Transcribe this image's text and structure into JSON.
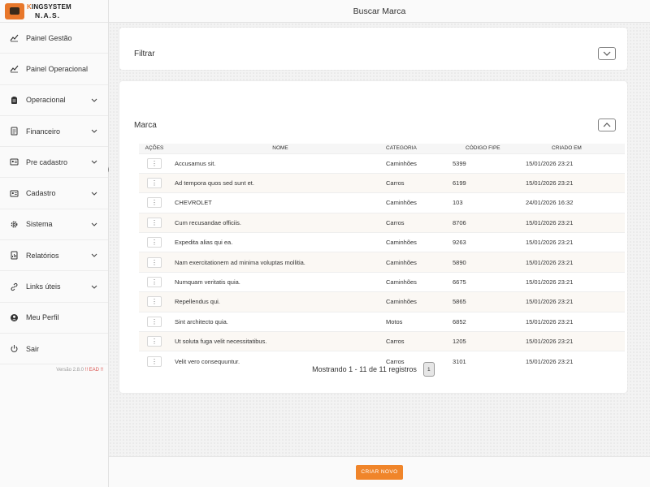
{
  "app": {
    "logo_line1_k": "K",
    "logo_line1_rest": "INGSYSTEM",
    "logo_line2": "N.A.S."
  },
  "header": {
    "title": "Buscar Marca"
  },
  "sidebar": {
    "items": [
      {
        "label": "Painel Gestão",
        "icon": "dashboard-chart-icon",
        "has_submenu": false
      },
      {
        "label": "Painel Operacional",
        "icon": "dashboard-chart-icon",
        "has_submenu": false
      },
      {
        "label": "Operacional",
        "icon": "clipboard-icon",
        "has_submenu": true
      },
      {
        "label": "Financeiro",
        "icon": "document-icon",
        "has_submenu": true
      },
      {
        "label": "Pre cadastro",
        "icon": "id-card-icon",
        "has_submenu": true
      },
      {
        "label": "Cadastro",
        "icon": "id-card-icon",
        "has_submenu": true
      },
      {
        "label": "Sistema",
        "icon": "gear-icon",
        "has_submenu": true
      },
      {
        "label": "Relatórios",
        "icon": "report-icon",
        "has_submenu": true
      },
      {
        "label": "Links úteis",
        "icon": "link-icon",
        "has_submenu": true
      },
      {
        "label": "Meu Perfil",
        "icon": "user-circle-icon",
        "has_submenu": false
      },
      {
        "label": "Sair",
        "icon": "power-icon",
        "has_submenu": false
      }
    ],
    "version_text": "Versão 2.8.0",
    "version_tag": "!! EAD !!"
  },
  "filter": {
    "title": "Filtrar"
  },
  "brand": {
    "title": "Marca",
    "columns": [
      "Ações",
      "Nome",
      "Categoria",
      "Código FIPE",
      "Criado em"
    ],
    "rows": [
      {
        "action": "⋮",
        "name": "Accusamus sit.",
        "category": "Caminhões",
        "fipe": "5399",
        "created": "15/01/2026 23:21"
      },
      {
        "action": "⋮",
        "name": "Ad tempora quos sed sunt et.",
        "category": "Carros",
        "fipe": "6199",
        "created": "15/01/2026 23:21"
      },
      {
        "action": "⋮",
        "name": "CHEVROLET",
        "category": "Caminhões",
        "fipe": "103",
        "created": "24/01/2026 16:32"
      },
      {
        "action": "⋮",
        "name": "Cum recusandae officiis.",
        "category": "Carros",
        "fipe": "8706",
        "created": "15/01/2026 23:21"
      },
      {
        "action": "⋮",
        "name": "Expedita alias qui ea.",
        "category": "Caminhões",
        "fipe": "9263",
        "created": "15/01/2026 23:21"
      },
      {
        "action": "⋮",
        "name": "Nam exercitationem ad minima voluptas mollitia.",
        "category": "Caminhões",
        "fipe": "5890",
        "created": "15/01/2026 23:21"
      },
      {
        "action": "⋮",
        "name": "Numquam veritatis quia.",
        "category": "Caminhões",
        "fipe": "6675",
        "created": "15/01/2026 23:21"
      },
      {
        "action": "⋮",
        "name": "Repellendus qui.",
        "category": "Caminhões",
        "fipe": "5865",
        "created": "15/01/2026 23:21"
      },
      {
        "action": "⋮",
        "name": "Sint architecto quia.",
        "category": "Motos",
        "fipe": "6852",
        "created": "15/01/2026 23:21"
      },
      {
        "action": "⋮",
        "name": "Ut soluta fuga velit necessitatibus.",
        "category": "Carros",
        "fipe": "1205",
        "created": "15/01/2026 23:21"
      },
      {
        "action": "⋮",
        "name": "Velit vero consequuntur.",
        "category": "Carros",
        "fipe": "3101",
        "created": "15/01/2026 23:21"
      }
    ],
    "pagination": {
      "summary": "Mostrando 1 - 11 de 11 registros",
      "current_page": "1"
    }
  },
  "footer": {
    "create_label": "CRIAR NOVO"
  },
  "colors": {
    "accent": "#f0852a",
    "danger": "#d9534f"
  }
}
